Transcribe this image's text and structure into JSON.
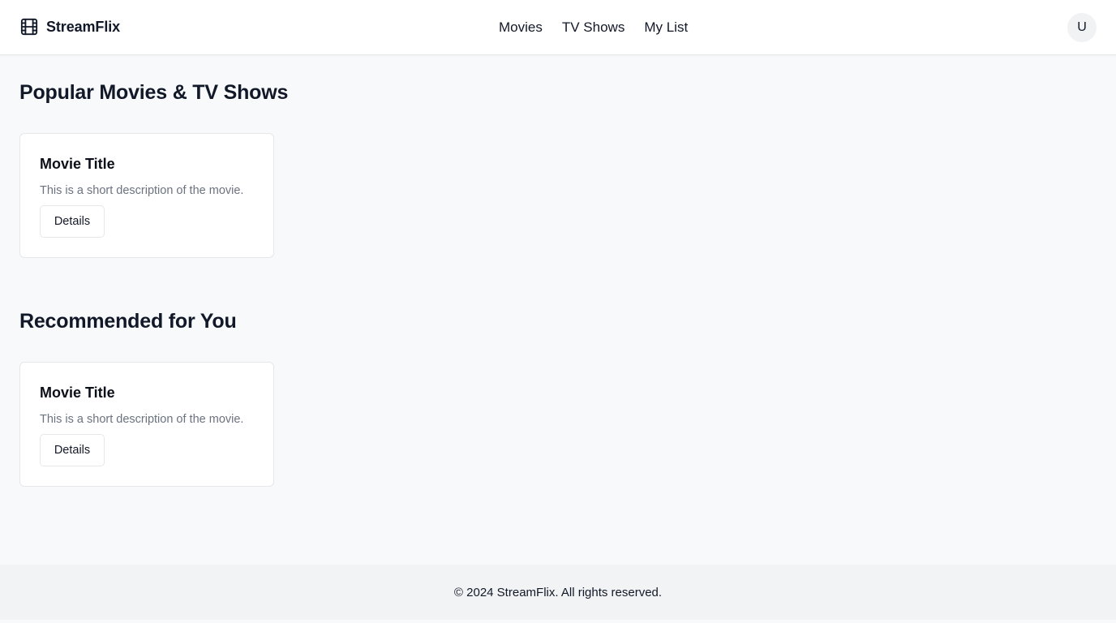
{
  "header": {
    "brand": "StreamFlix",
    "brand_icon": "film-icon",
    "nav": [
      "Movies",
      "TV Shows",
      "My List"
    ],
    "avatar_initial": "U"
  },
  "sections": [
    {
      "title": "Popular Movies & TV Shows",
      "cards": [
        {
          "title": "Movie Title",
          "description": "This is a short description of the movie.",
          "button": "Details"
        }
      ]
    },
    {
      "title": "Recommended for You",
      "cards": [
        {
          "title": "Movie Title",
          "description": "This is a short description of the movie.",
          "button": "Details"
        }
      ]
    }
  ],
  "footer": {
    "text": "© 2024 StreamFlix. All rights reserved."
  },
  "colors": {
    "page_background": "#f8f9fb",
    "header_background": "#ffffff",
    "footer_background": "#f2f3f5",
    "text_primary": "#111827",
    "text_muted": "#6b7280",
    "border": "#e5e7eb"
  }
}
